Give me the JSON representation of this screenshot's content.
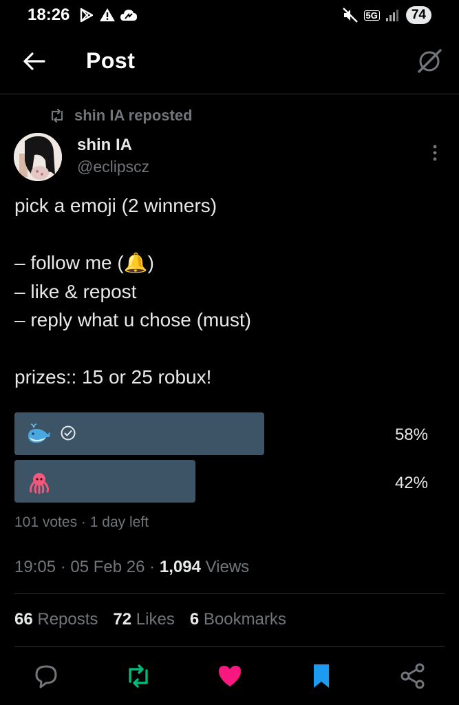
{
  "status_bar": {
    "time": "18:26",
    "network": "5G",
    "battery": "74",
    "icons": [
      "play-store-icon",
      "warning-icon",
      "cloud-icon",
      "mute-icon",
      "signal-icon"
    ]
  },
  "header": {
    "title": "Post",
    "back_icon": "arrow-left-icon",
    "grok_icon": "grok-icon"
  },
  "repost": {
    "label": "shin IA reposted"
  },
  "author": {
    "name": "shin IA",
    "handle": "@eclipscz"
  },
  "post": {
    "text": "pick a emoji (2 winners)\n\n– follow me (🔔)\n– like & repost\n– reply what u chose (must)\n\nprizes:: 15 or 25 robux!"
  },
  "poll": {
    "options": [
      {
        "emoji": "whale",
        "percent_label": "58%",
        "percent": 58,
        "chosen": true
      },
      {
        "emoji": "octopus",
        "percent_label": "42%",
        "percent": 42,
        "chosen": false
      }
    ],
    "votes": "101 votes",
    "time_left": "1 day left"
  },
  "meta": {
    "time": "19:05",
    "date": "05 Feb 26",
    "views_count": "1,094",
    "views_label": "Views"
  },
  "stats": {
    "reposts_count": "66",
    "reposts_label": "Reposts",
    "likes_count": "72",
    "likes_label": "Likes",
    "bookmarks_count": "6",
    "bookmarks_label": "Bookmarks"
  },
  "colors": {
    "background": "#000000",
    "text": "#e7e9ea",
    "muted": "#71767b",
    "poll_bar": "#3d5366",
    "repost_green": "#00ba7c",
    "like_pink": "#f91880",
    "bookmark_blue": "#1d9bf0"
  }
}
